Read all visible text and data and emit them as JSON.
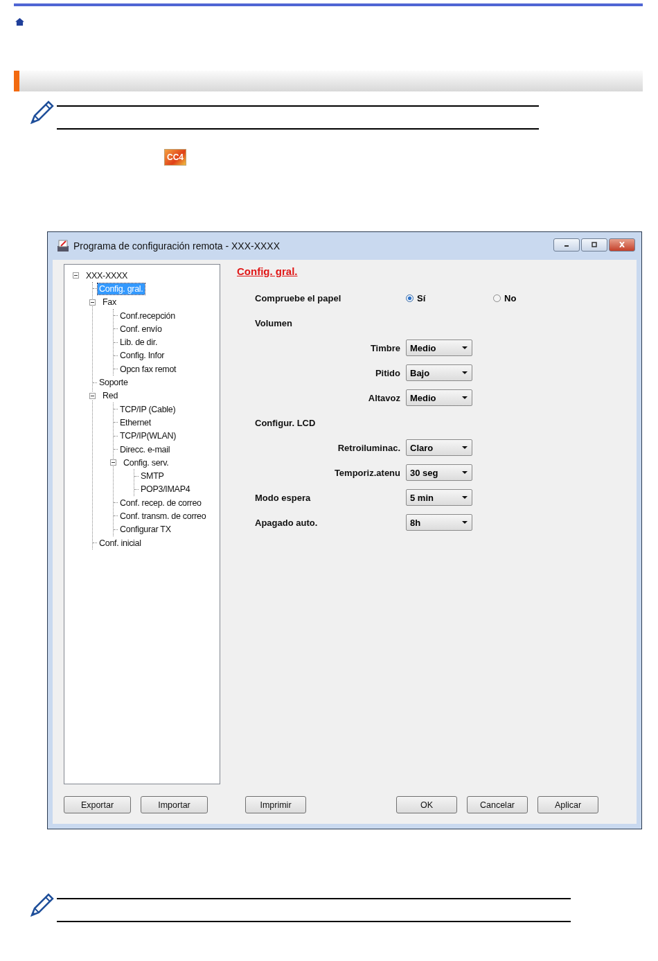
{
  "app_icon_label": "CC4",
  "window": {
    "title": "Programa de configuración remota - XXX-XXXX"
  },
  "tree": [
    {
      "label": "XXX-XXXX",
      "selected": false,
      "expanded": true,
      "children": [
        {
          "label": "Config. gral.",
          "selected": true
        },
        {
          "label": "Fax",
          "selected": false,
          "expanded": true,
          "children": [
            {
              "label": "Conf.recepción",
              "selected": false
            },
            {
              "label": "Conf. envío",
              "selected": false
            },
            {
              "label": "Lib. de dir.",
              "selected": false
            },
            {
              "label": "Config. Infor",
              "selected": false
            },
            {
              "label": "Opcn fax remot",
              "selected": false
            }
          ]
        },
        {
          "label": "Soporte",
          "selected": false
        },
        {
          "label": "Red",
          "selected": false,
          "expanded": true,
          "children": [
            {
              "label": "TCP/IP (Cable)",
              "selected": false
            },
            {
              "label": "Ethernet",
              "selected": false
            },
            {
              "label": "TCP/IP(WLAN)",
              "selected": false
            },
            {
              "label": "Direcc. e-mail",
              "selected": false
            },
            {
              "label": "Config. serv.",
              "selected": false,
              "expanded": true,
              "children": [
                {
                  "label": "SMTP",
                  "selected": false
                },
                {
                  "label": "POP3/IMAP4",
                  "selected": false
                }
              ]
            },
            {
              "label": "Conf. recep. de correo",
              "selected": false
            },
            {
              "label": "Conf. transm. de correo",
              "selected": false
            },
            {
              "label": "Configurar TX",
              "selected": false
            }
          ]
        },
        {
          "label": "Conf. inicial",
          "selected": false
        }
      ]
    }
  ],
  "panel": {
    "title": "Config. gral.",
    "settings": [
      {
        "kind": "radio",
        "label": "Compruebe  el papel",
        "options": [
          {
            "label": "Sí",
            "selected": true
          },
          {
            "label": "No",
            "selected": false
          }
        ]
      },
      {
        "kind": "heading",
        "label": "Volumen",
        "children": [
          {
            "kind": "select",
            "label": "Timbre",
            "value": "Medio"
          },
          {
            "kind": "select",
            "label": "Pitido",
            "value": "Bajo"
          },
          {
            "kind": "select",
            "label": "Altavoz",
            "value": "Medio"
          }
        ]
      },
      {
        "kind": "heading",
        "label": "Configur. LCD",
        "children": [
          {
            "kind": "select",
            "label": "Retroiluminac.",
            "value": "Claro"
          },
          {
            "kind": "select",
            "label": "Temporiz.atenu",
            "value": "30 seg"
          }
        ]
      },
      {
        "kind": "select",
        "label": "Modo espera",
        "value": "5 min"
      },
      {
        "kind": "select",
        "label": "Apagado auto.",
        "value": "8h"
      }
    ]
  },
  "tree_buttons": [
    "Exportar",
    "Importar"
  ],
  "panel_buttons": [
    "Imprimir"
  ],
  "dialog_buttons": [
    "OK",
    "Cancelar",
    "Aplicar"
  ]
}
